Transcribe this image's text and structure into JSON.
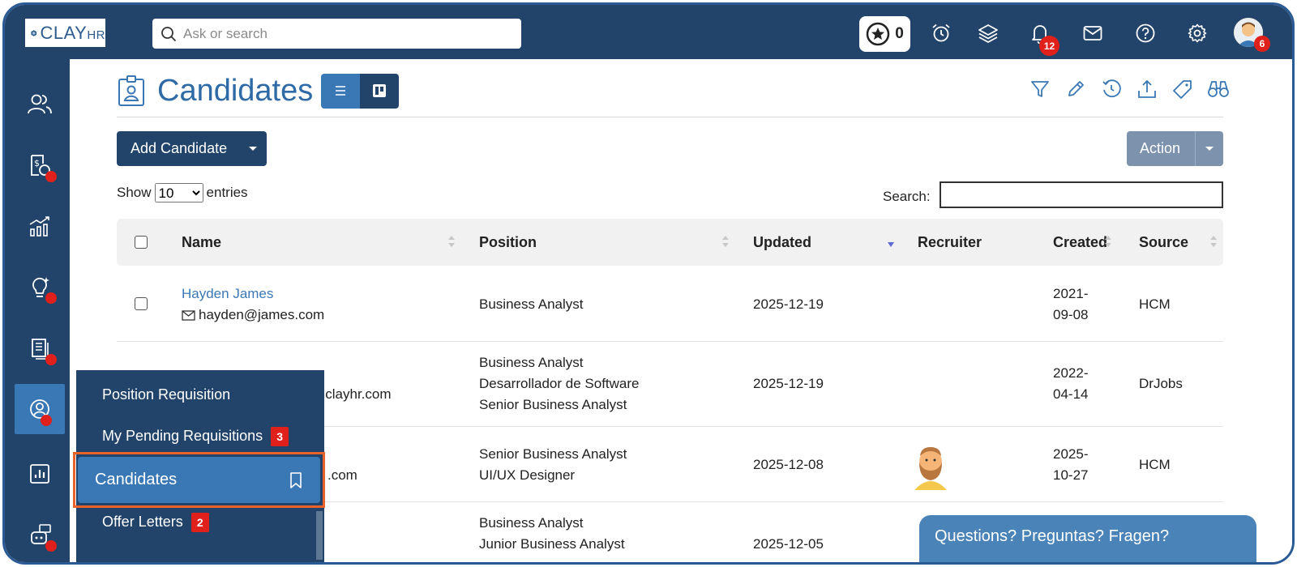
{
  "app": {
    "logo_text": "CLAY",
    "logo_suffix": "HR",
    "search_placeholder": "Ask or search",
    "star_count": "0",
    "notification_count": "12",
    "avatar_badge": "6"
  },
  "page": {
    "title": "Candidates",
    "add_button": "Add Candidate",
    "action_button": "Action",
    "show_label": "Show",
    "entries_value": "10",
    "entries_label": "entries",
    "search_label": "Search:"
  },
  "table": {
    "columns": [
      "Name",
      "Position",
      "Updated",
      "Recruiter",
      "Created",
      "Source"
    ],
    "rows": [
      {
        "name": "Hayden James",
        "email": "hayden@james.com",
        "positions": [
          "Business Analyst"
        ],
        "updated": "2025-12-19",
        "created_1": "2021-",
        "created_2": "09-08",
        "source": "HCM"
      },
      {
        "name": "",
        "email": "@clayhr.com",
        "positions": [
          "Business Analyst",
          "Desarrollador de Software",
          "Senior Business Analyst"
        ],
        "updated": "2025-12-19",
        "created_1": "2022-",
        "created_2": "04-14",
        "source": "DrJobs"
      },
      {
        "name": "",
        "email": ".com",
        "positions": [
          "Senior Business Analyst",
          "UI/UX Designer"
        ],
        "updated": "2025-12-08",
        "created_1": "2025-",
        "created_2": "10-27",
        "source": "HCM"
      },
      {
        "name": "",
        "email": "",
        "positions": [
          "Business Analyst",
          "Junior Business Analyst"
        ],
        "updated": "2025-12-05",
        "created_1": "",
        "created_2": "",
        "source": ""
      }
    ]
  },
  "menu": {
    "items": [
      {
        "label": "Position Requisition",
        "badge": ""
      },
      {
        "label": "My Pending Requisitions",
        "badge": "3"
      },
      {
        "label": "Candidates",
        "badge": ""
      },
      {
        "label": "Offer Letters",
        "badge": "2"
      }
    ]
  },
  "chat": {
    "label": "Questions? Preguntas? Fragen?"
  },
  "colors": {
    "nav": "#23446a",
    "accent": "#3a78b5",
    "badge": "#e0201b",
    "highlight": "#e8622a"
  }
}
